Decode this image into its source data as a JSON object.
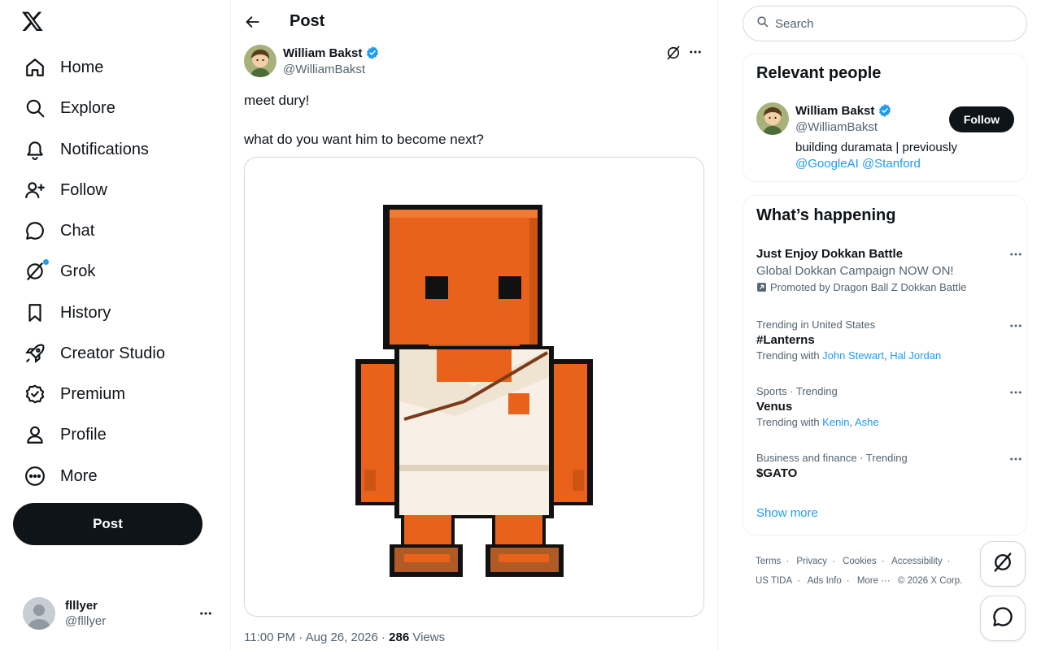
{
  "nav": {
    "items": [
      {
        "label": "Home",
        "icon": "home-icon"
      },
      {
        "label": "Explore",
        "icon": "search-icon"
      },
      {
        "label": "Notifications",
        "icon": "bell-icon"
      },
      {
        "label": "Follow",
        "icon": "person-add-icon"
      },
      {
        "label": "Chat",
        "icon": "chat-icon"
      },
      {
        "label": "Grok",
        "icon": "grok-icon"
      },
      {
        "label": "History",
        "icon": "bookmark-icon"
      },
      {
        "label": "Creator Studio",
        "icon": "rocket-icon"
      },
      {
        "label": "Premium",
        "icon": "premium-icon"
      },
      {
        "label": "Profile",
        "icon": "person-icon"
      },
      {
        "label": "More",
        "icon": "more-circle-icon"
      }
    ],
    "post_button": "Post"
  },
  "account": {
    "name": "flllyer",
    "handle": "@flllyer"
  },
  "header": {
    "title": "Post"
  },
  "post": {
    "author_name": "William Bakst",
    "author_handle": "@WilliamBakst",
    "text_line1": "meet dury!",
    "text_line2": "what do you want him to become next?",
    "time": "11:00 PM · Aug 26, 2026 · ",
    "views_count": "286",
    "views_label": " Views"
  },
  "search": {
    "placeholder": "Search"
  },
  "relevant_people": {
    "title": "Relevant people",
    "name": "William Bakst",
    "handle": "@WilliamBakst",
    "bio_text": "building duramata | previously",
    "bio_link1": "@GoogleAI",
    "bio_link2": "@Stanford",
    "follow_label": "Follow"
  },
  "whats_happening": {
    "title": "What’s happening",
    "promo": {
      "title": "Just Enjoy Dokkan Battle",
      "desc": "Global Dokkan Campaign NOW ON!",
      "by": "Promoted by Dragon Ball Z Dokkan Battle"
    },
    "trends": [
      {
        "context": "Trending in United States",
        "title": "#Lanterns",
        "with_label": "Trending with ",
        "with_a": "John Stewart",
        "with_b": "Hal Jordan"
      },
      {
        "context": "Sports · Trending",
        "title": "Venus",
        "with_label": "Trending with ",
        "with_a": "Kenin",
        "with_b": "Ashe"
      },
      {
        "context": "Business and finance · Trending",
        "title": "$GATO"
      }
    ],
    "show_more": "Show more"
  },
  "footer": {
    "links_row1": [
      "Terms",
      "Privacy",
      "Cookies",
      "Accessibility"
    ],
    "links_row2": [
      "US TIDA",
      "Ads Info",
      "More ···"
    ],
    "copyright": "© 2026 X Corp."
  },
  "colors": {
    "accent": "#1d9bf0",
    "text": "#0f1419",
    "secondary": "#536471",
    "character_orange": "#e8621c"
  }
}
